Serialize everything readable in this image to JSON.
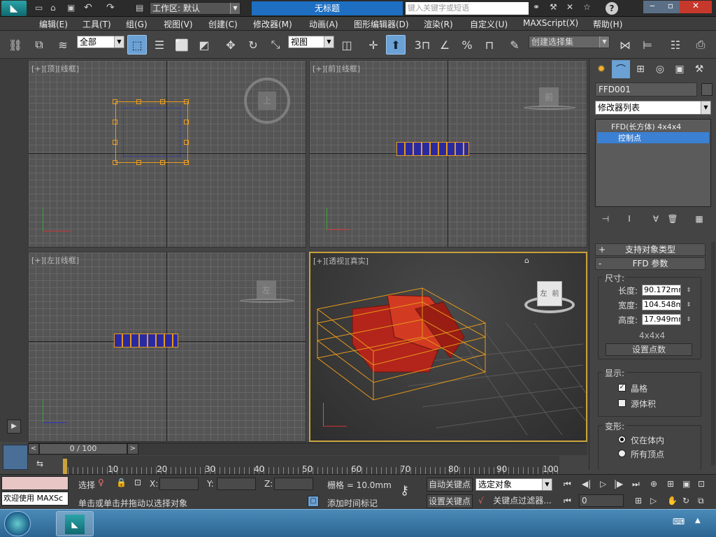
{
  "title_bar": {
    "workspace_label": "工作区: 默认",
    "doc_title": "无标题",
    "search_placeholder": "键入关键字或短语"
  },
  "menu": [
    "编辑(E)",
    "工具(T)",
    "组(G)",
    "视图(V)",
    "创建(C)",
    "修改器(M)",
    "动画(A)",
    "图形编辑器(D)",
    "渲染(R)",
    "自定义(U)",
    "MAXScript(X)",
    "帮助(H)"
  ],
  "toolbar": {
    "selection_filter": "全部",
    "ref_coord": "视图",
    "named_selection_placeholder": "创建选择集",
    "snap_label": "3",
    "percent_label": "%"
  },
  "viewports": {
    "top": {
      "plus": "[+]",
      "name": "[顶]",
      "shade": "[线框]",
      "cube": "上"
    },
    "front": {
      "plus": "[+]",
      "name": "[前]",
      "shade": "[线框]",
      "cube": "前"
    },
    "left": {
      "plus": "[+]",
      "name": "[左]",
      "shade": "[线框]",
      "cube": "左"
    },
    "persp": {
      "plus": "[+]",
      "name": "[透视]",
      "shade": "[真实]",
      "cube_left": "左",
      "cube_right": "前"
    }
  },
  "right_panel": {
    "object_name": "FFD001",
    "modifier_list": "修改器列表",
    "stack": [
      "FFD(长方体) 4x4x4",
      "控制点"
    ],
    "rollout_support": "支持对象类型",
    "rollout_params": "FFD 参数",
    "dims_title": "尺寸:",
    "length_label": "长度:",
    "length_value": "90.172mm",
    "width_label": "宽度:",
    "width_value": "104.548mm",
    "height_label": "高度:",
    "height_value": "17.949mm",
    "lattice_dims": "4x4x4",
    "set_points": "设置点数",
    "display_title": "显示:",
    "lattice_label": "晶格",
    "source_volume_label": "源体积",
    "deform_title": "变形:",
    "only_in_volume": "仅在体内",
    "all_vertices": "所有顶点"
  },
  "timeline": {
    "frame_display": "0 / 100",
    "ticks": [
      "10",
      "20",
      "30",
      "40",
      "50",
      "60",
      "70",
      "80",
      "90",
      "100"
    ]
  },
  "status": {
    "maxscript_listener": "欢迎使用 MAXSc",
    "selected_count": "选择",
    "x_label": "X:",
    "y_label": "Y:",
    "z_label": "Z:",
    "grid": "栅格 = 10.0mm",
    "prompt": "单击或单击并拖动以选择对象",
    "add_time_tag": "添加时间标记",
    "auto_key": "自动关键点",
    "set_key": "设置关键点",
    "key_filter_combo": "选定对象",
    "key_filters": "关键点过滤器...",
    "current_frame": "0"
  },
  "colors": {
    "accent": "#6ba1d4",
    "active_viewport": "#c9a23c",
    "lattice": "#e79a1a",
    "object": "#c0281b"
  }
}
